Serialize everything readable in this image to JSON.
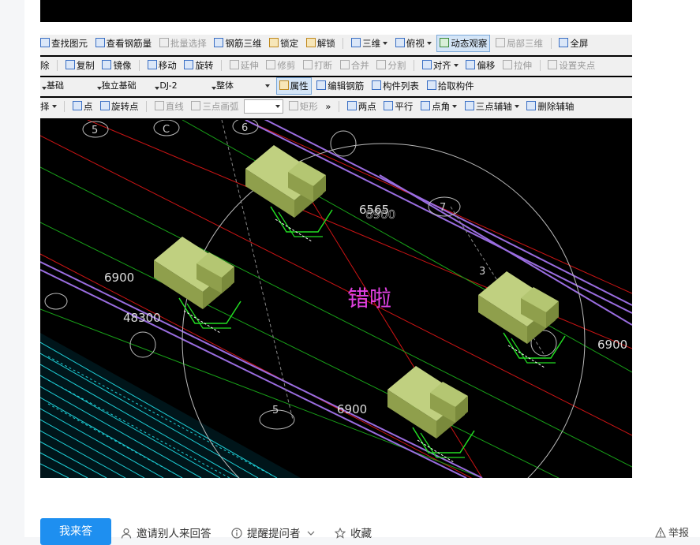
{
  "toolbar1": {
    "items": [
      "查找图元",
      "查看钢筋量",
      "批量选择",
      "钢筋三维",
      "锁定",
      "解锁"
    ],
    "view_3d": "三维",
    "view_top": "俯视",
    "dynamic_observe": "动态观察",
    "partial_3d": "局部三维",
    "fullscreen": "全屏"
  },
  "toolbar2": {
    "delete": "除",
    "copy": "复制",
    "mirror": "镜像",
    "move": "移动",
    "rotate": "旋转",
    "extend": "延伸",
    "trim": "修剪",
    "break": "打断",
    "merge": "合并",
    "split": "分割",
    "align": "对齐",
    "offset": "偏移",
    "stretch": "拉伸",
    "set_grip": "设置夹点"
  },
  "toolbar3": {
    "combo1": "基础",
    "combo2": "独立基础",
    "combo3": "DJ-2",
    "combo4": "整体",
    "properties": "属性",
    "edit_rebar": "编辑钢筋",
    "component_list": "构件列表",
    "pick_component": "拾取构件"
  },
  "toolbar4": {
    "select": "择",
    "point": "点",
    "rotate_point": "旋转点",
    "line": "直线",
    "arc3": "三点画弧",
    "rect": "矩形",
    "more": "»",
    "two_point": "两点",
    "parallel": "平行",
    "point_angle": "点角",
    "three_point_axis": "三点辅轴",
    "delete_axis": "删除辅轴"
  },
  "canvas": {
    "overlay_text": "错啦",
    "dims": [
      "6900",
      "6565",
      "6900",
      "6900",
      "6900",
      "48300"
    ],
    "axis_labels": [
      "5",
      "C",
      "6",
      "7",
      "3",
      "5"
    ]
  },
  "actions": {
    "answer": "我来答",
    "invite": "邀请别人来回答",
    "remind": "提醒提问者",
    "favorite": "收藏",
    "report": "举报"
  },
  "colors": {
    "primary": "#1e8ff0",
    "overlay_text": "#e040e0",
    "footing": "#9aab5a",
    "grid_red": "#d01818",
    "grid_purple": "#9a6de0",
    "rebar_green": "#18d018"
  }
}
